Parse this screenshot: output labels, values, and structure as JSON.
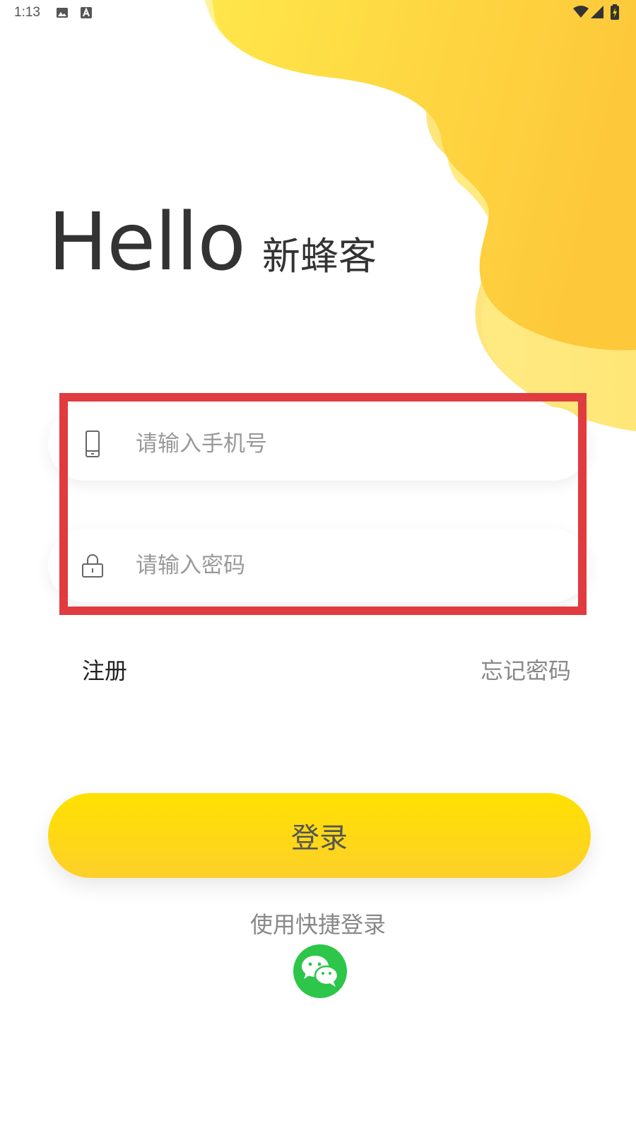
{
  "status_bar": {
    "time": "1:13"
  },
  "greeting": {
    "hello": "Hello",
    "brand": "新蜂客"
  },
  "login_form": {
    "phone_placeholder": "请输入手机号",
    "phone_icon": "phone-icon",
    "password_placeholder": "请输入密码",
    "password_icon": "lock-icon"
  },
  "links": {
    "register": "注册",
    "forgot_password": "忘记密码"
  },
  "login_button_label": "登录",
  "quick_login": {
    "label": "使用快捷登录",
    "wechat_icon": "wechat-icon"
  },
  "colors": {
    "accent_yellow": "#FFE100",
    "wechat_green": "#2DC54A",
    "highlight_red": "#E13B3F"
  }
}
